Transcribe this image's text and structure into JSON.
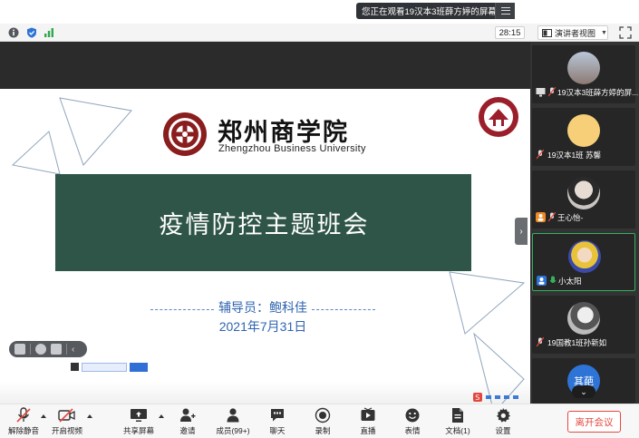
{
  "notice": {
    "text": "您正在观看19汉本3班薛方婷的屏幕"
  },
  "status_bar": {
    "timer": "28:15",
    "view_mode": "演讲者视图"
  },
  "slide": {
    "school_name_cn": "郑州商学院",
    "school_name_en": "Zhengzhou Business University",
    "banner_title": "疫情防控主题班会",
    "counselor": "辅导员：鲍科佳",
    "date": "2021年7月31日"
  },
  "participants": [
    {
      "name": "19汉本3班薛方婷的屏...",
      "active": false
    },
    {
      "name": "19汉本1班 苏馨",
      "active": false
    },
    {
      "name": "王心怡-",
      "active": false
    },
    {
      "name": "小太阳",
      "active": true
    },
    {
      "name": "19国教1班孙新如",
      "active": false
    },
    {
      "name": "其葩",
      "active": false
    }
  ],
  "toolbar": {
    "unmute": "解除静音",
    "start_video": "开启视频",
    "share_screen": "共享屏幕",
    "invite": "邀请",
    "members": "成员(99+)",
    "chat": "聊天",
    "record": "录制",
    "live": "直播",
    "reactions": "表情",
    "docs": "文档(1)",
    "settings": "设置",
    "leave": "离开会议"
  },
  "colors": {
    "banner_green": "#2f5549",
    "text_blue": "#2f64b0",
    "active_green": "#34b25d",
    "leave_red": "#e4493f"
  }
}
